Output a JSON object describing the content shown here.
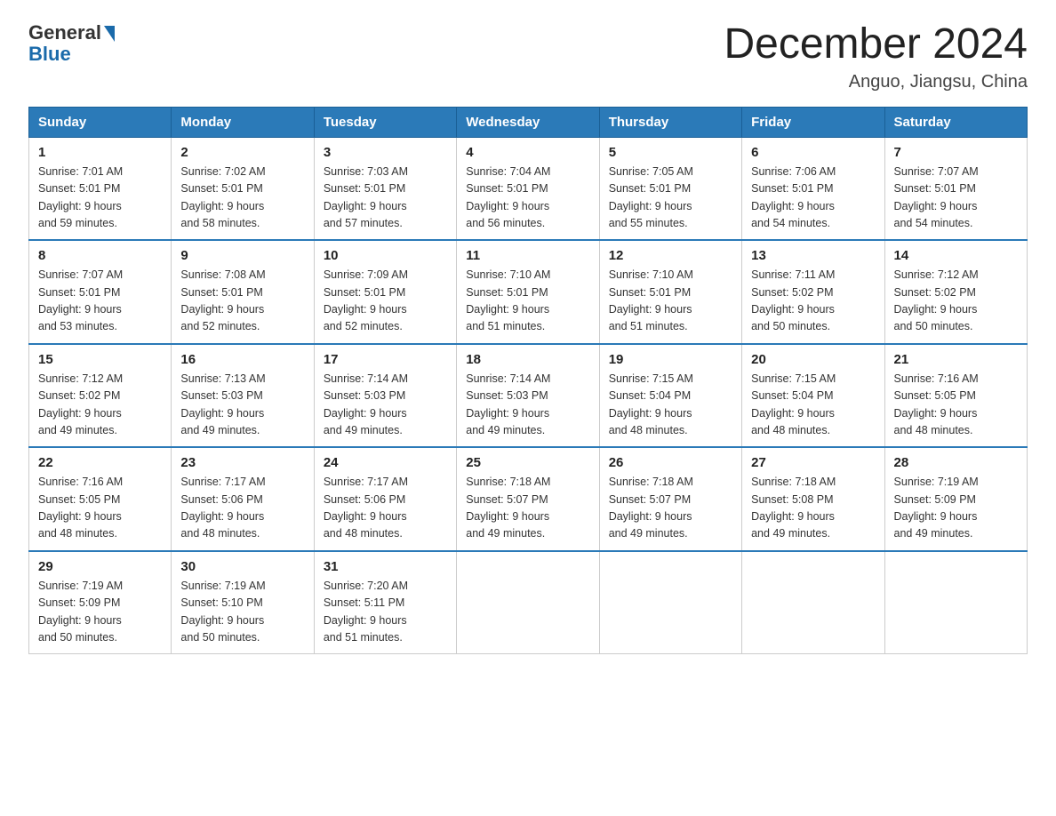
{
  "logo": {
    "general": "General",
    "blue": "Blue"
  },
  "title": "December 2024",
  "subtitle": "Anguo, Jiangsu, China",
  "days_of_week": [
    "Sunday",
    "Monday",
    "Tuesday",
    "Wednesday",
    "Thursday",
    "Friday",
    "Saturday"
  ],
  "weeks": [
    [
      {
        "day": "1",
        "sunrise": "7:01 AM",
        "sunset": "5:01 PM",
        "daylight": "9 hours and 59 minutes."
      },
      {
        "day": "2",
        "sunrise": "7:02 AM",
        "sunset": "5:01 PM",
        "daylight": "9 hours and 58 minutes."
      },
      {
        "day": "3",
        "sunrise": "7:03 AM",
        "sunset": "5:01 PM",
        "daylight": "9 hours and 57 minutes."
      },
      {
        "day": "4",
        "sunrise": "7:04 AM",
        "sunset": "5:01 PM",
        "daylight": "9 hours and 56 minutes."
      },
      {
        "day": "5",
        "sunrise": "7:05 AM",
        "sunset": "5:01 PM",
        "daylight": "9 hours and 55 minutes."
      },
      {
        "day": "6",
        "sunrise": "7:06 AM",
        "sunset": "5:01 PM",
        "daylight": "9 hours and 54 minutes."
      },
      {
        "day": "7",
        "sunrise": "7:07 AM",
        "sunset": "5:01 PM",
        "daylight": "9 hours and 54 minutes."
      }
    ],
    [
      {
        "day": "8",
        "sunrise": "7:07 AM",
        "sunset": "5:01 PM",
        "daylight": "9 hours and 53 minutes."
      },
      {
        "day": "9",
        "sunrise": "7:08 AM",
        "sunset": "5:01 PM",
        "daylight": "9 hours and 52 minutes."
      },
      {
        "day": "10",
        "sunrise": "7:09 AM",
        "sunset": "5:01 PM",
        "daylight": "9 hours and 52 minutes."
      },
      {
        "day": "11",
        "sunrise": "7:10 AM",
        "sunset": "5:01 PM",
        "daylight": "9 hours and 51 minutes."
      },
      {
        "day": "12",
        "sunrise": "7:10 AM",
        "sunset": "5:01 PM",
        "daylight": "9 hours and 51 minutes."
      },
      {
        "day": "13",
        "sunrise": "7:11 AM",
        "sunset": "5:02 PM",
        "daylight": "9 hours and 50 minutes."
      },
      {
        "day": "14",
        "sunrise": "7:12 AM",
        "sunset": "5:02 PM",
        "daylight": "9 hours and 50 minutes."
      }
    ],
    [
      {
        "day": "15",
        "sunrise": "7:12 AM",
        "sunset": "5:02 PM",
        "daylight": "9 hours and 49 minutes."
      },
      {
        "day": "16",
        "sunrise": "7:13 AM",
        "sunset": "5:03 PM",
        "daylight": "9 hours and 49 minutes."
      },
      {
        "day": "17",
        "sunrise": "7:14 AM",
        "sunset": "5:03 PM",
        "daylight": "9 hours and 49 minutes."
      },
      {
        "day": "18",
        "sunrise": "7:14 AM",
        "sunset": "5:03 PM",
        "daylight": "9 hours and 49 minutes."
      },
      {
        "day": "19",
        "sunrise": "7:15 AM",
        "sunset": "5:04 PM",
        "daylight": "9 hours and 48 minutes."
      },
      {
        "day": "20",
        "sunrise": "7:15 AM",
        "sunset": "5:04 PM",
        "daylight": "9 hours and 48 minutes."
      },
      {
        "day": "21",
        "sunrise": "7:16 AM",
        "sunset": "5:05 PM",
        "daylight": "9 hours and 48 minutes."
      }
    ],
    [
      {
        "day": "22",
        "sunrise": "7:16 AM",
        "sunset": "5:05 PM",
        "daylight": "9 hours and 48 minutes."
      },
      {
        "day": "23",
        "sunrise": "7:17 AM",
        "sunset": "5:06 PM",
        "daylight": "9 hours and 48 minutes."
      },
      {
        "day": "24",
        "sunrise": "7:17 AM",
        "sunset": "5:06 PM",
        "daylight": "9 hours and 48 minutes."
      },
      {
        "day": "25",
        "sunrise": "7:18 AM",
        "sunset": "5:07 PM",
        "daylight": "9 hours and 49 minutes."
      },
      {
        "day": "26",
        "sunrise": "7:18 AM",
        "sunset": "5:07 PM",
        "daylight": "9 hours and 49 minutes."
      },
      {
        "day": "27",
        "sunrise": "7:18 AM",
        "sunset": "5:08 PM",
        "daylight": "9 hours and 49 minutes."
      },
      {
        "day": "28",
        "sunrise": "7:19 AM",
        "sunset": "5:09 PM",
        "daylight": "9 hours and 49 minutes."
      }
    ],
    [
      {
        "day": "29",
        "sunrise": "7:19 AM",
        "sunset": "5:09 PM",
        "daylight": "9 hours and 50 minutes."
      },
      {
        "day": "30",
        "sunrise": "7:19 AM",
        "sunset": "5:10 PM",
        "daylight": "9 hours and 50 minutes."
      },
      {
        "day": "31",
        "sunrise": "7:20 AM",
        "sunset": "5:11 PM",
        "daylight": "9 hours and 51 minutes."
      },
      null,
      null,
      null,
      null
    ]
  ],
  "labels": {
    "sunrise": "Sunrise:",
    "sunset": "Sunset:",
    "daylight": "Daylight:"
  }
}
